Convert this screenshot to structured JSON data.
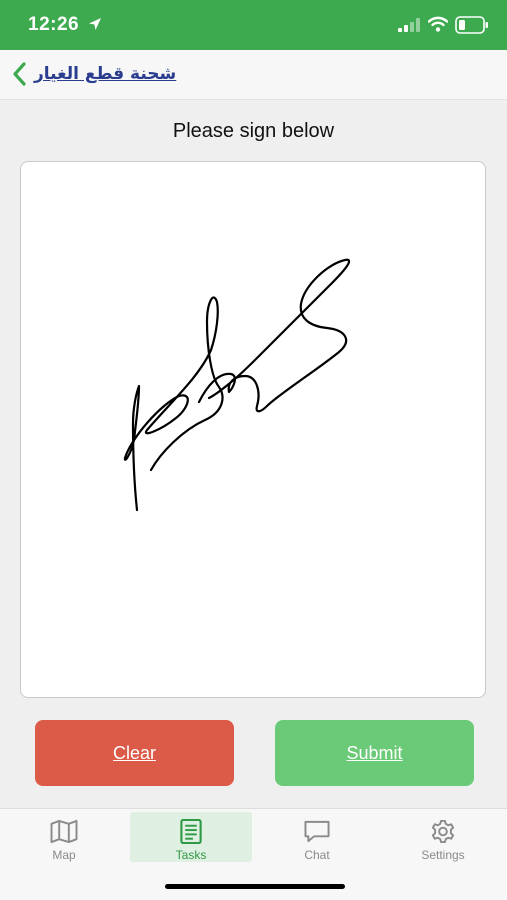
{
  "status_bar": {
    "time": "12:26",
    "background": "#3daa4f"
  },
  "nav": {
    "title": "شحنة قطع الغيار",
    "back_icon": "chevron-left-icon"
  },
  "instruction": "Please sign below",
  "actions": {
    "clear_label": "Clear",
    "submit_label": "Submit",
    "clear_color": "#dc5a48",
    "submit_color": "#6bca77"
  },
  "tabs": [
    {
      "label": "Map",
      "icon": "map-icon",
      "active": false
    },
    {
      "label": "Tasks",
      "icon": "tasks-icon",
      "active": true
    },
    {
      "label": "Chat",
      "icon": "chat-icon",
      "active": false
    },
    {
      "label": "Settings",
      "icon": "gear-icon",
      "active": false
    }
  ]
}
